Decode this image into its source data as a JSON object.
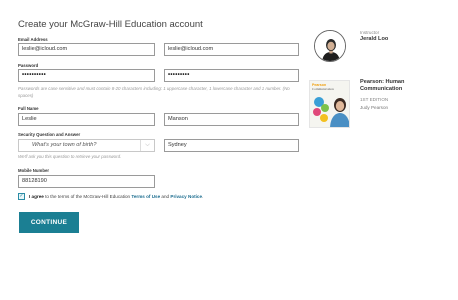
{
  "title": "Create your McGraw-Hill Education account",
  "email": {
    "label": "Email Address",
    "value": "leslie@icloud.com",
    "confirm_value": "leslie@icloud.com"
  },
  "password": {
    "label": "Password",
    "value": "••••••••••",
    "confirm_value": "•••••••••",
    "hint": "Passwords are case sensitive and must contain 8-20 characters including: 1 uppercase character, 1 lowercase character and 1 number. (No spaces)"
  },
  "full_name": {
    "label": "Full Name",
    "first": "Leslie",
    "last": "Manson"
  },
  "security": {
    "label": "Security Question and Answer",
    "question": "What's your town of birth?",
    "answer": "Sydney",
    "hint": "We'll ask you this question to retrieve your password."
  },
  "mobile": {
    "label": "Mobile Number",
    "value": "88128190"
  },
  "agree": {
    "checked": "✓",
    "prefix": "I agree",
    "middle": " to the terms of the McGraw-Hill Education ",
    "terms": "Terms of Use",
    "and": " and ",
    "privacy": "Privacy Notice",
    "end": "."
  },
  "continue_label": "CONTINUE",
  "instructor": {
    "label": "Instructor",
    "name": "Jerald Loo"
  },
  "book": {
    "cover_brand": "Pearson",
    "cover_title": "Communication",
    "title_line1": "Pearson: Human",
    "title_line2": "Communication",
    "edition": "1ST EDITION",
    "author": "Judy Pearson"
  },
  "colors": {
    "accent": "#1b7f93",
    "link": "#1c6d8f"
  }
}
